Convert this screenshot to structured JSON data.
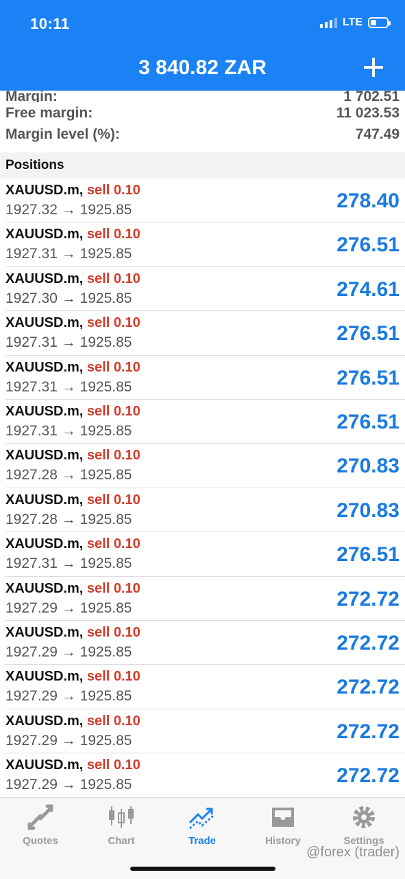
{
  "status_bar": {
    "time": "10:11",
    "network": "LTE"
  },
  "header": {
    "balance": "3 840.82 ZAR"
  },
  "account": [
    {
      "label": "Margin:",
      "value": "1 702.51"
    },
    {
      "label": "Free margin:",
      "value": "11 023.53"
    },
    {
      "label": "Margin level (%):",
      "value": "747.49"
    }
  ],
  "positions_section": {
    "title": "Positions"
  },
  "positions": [
    {
      "symbol": "XAUUSD.m,",
      "type": "sell 0.10",
      "prices": "1927.32 → 1925.85",
      "profit": "278.40"
    },
    {
      "symbol": "XAUUSD.m,",
      "type": "sell 0.10",
      "prices": "1927.31 → 1925.85",
      "profit": "276.51"
    },
    {
      "symbol": "XAUUSD.m,",
      "type": "sell 0.10",
      "prices": "1927.30 → 1925.85",
      "profit": "274.61"
    },
    {
      "symbol": "XAUUSD.m,",
      "type": "sell 0.10",
      "prices": "1927.31 → 1925.85",
      "profit": "276.51"
    },
    {
      "symbol": "XAUUSD.m,",
      "type": "sell 0.10",
      "prices": "1927.31 → 1925.85",
      "profit": "276.51"
    },
    {
      "symbol": "XAUUSD.m,",
      "type": "sell 0.10",
      "prices": "1927.31 → 1925.85",
      "profit": "276.51"
    },
    {
      "symbol": "XAUUSD.m,",
      "type": "sell 0.10",
      "prices": "1927.28 → 1925.85",
      "profit": "270.83"
    },
    {
      "symbol": "XAUUSD.m,",
      "type": "sell 0.10",
      "prices": "1927.28 → 1925.85",
      "profit": "270.83"
    },
    {
      "symbol": "XAUUSD.m,",
      "type": "sell 0.10",
      "prices": "1927.31 → 1925.85",
      "profit": "276.51"
    },
    {
      "symbol": "XAUUSD.m,",
      "type": "sell 0.10",
      "prices": "1927.29 → 1925.85",
      "profit": "272.72"
    },
    {
      "symbol": "XAUUSD.m,",
      "type": "sell 0.10",
      "prices": "1927.29 → 1925.85",
      "profit": "272.72"
    },
    {
      "symbol": "XAUUSD.m,",
      "type": "sell 0.10",
      "prices": "1927.29 → 1925.85",
      "profit": "272.72"
    },
    {
      "symbol": "XAUUSD.m,",
      "type": "sell 0.10",
      "prices": "1927.29 → 1925.85",
      "profit": "272.72"
    },
    {
      "symbol": "XAUUSD.m,",
      "type": "sell 0.10",
      "prices": "1927.29 → 1925.85",
      "profit": "272.72"
    }
  ],
  "tabs": [
    {
      "label": "Quotes",
      "icon": "quotes-icon",
      "active": false
    },
    {
      "label": "Chart",
      "icon": "chart-icon",
      "active": false
    },
    {
      "label": "Trade",
      "icon": "trade-icon",
      "active": true
    },
    {
      "label": "History",
      "icon": "history-icon",
      "active": false
    },
    {
      "label": "Settings",
      "icon": "settings-icon",
      "active": false
    }
  ],
  "watermark": "@forex (trader)",
  "colors": {
    "accent": "#1a82f4",
    "sell": "#d43b2a",
    "profit": "#1a7be0"
  }
}
